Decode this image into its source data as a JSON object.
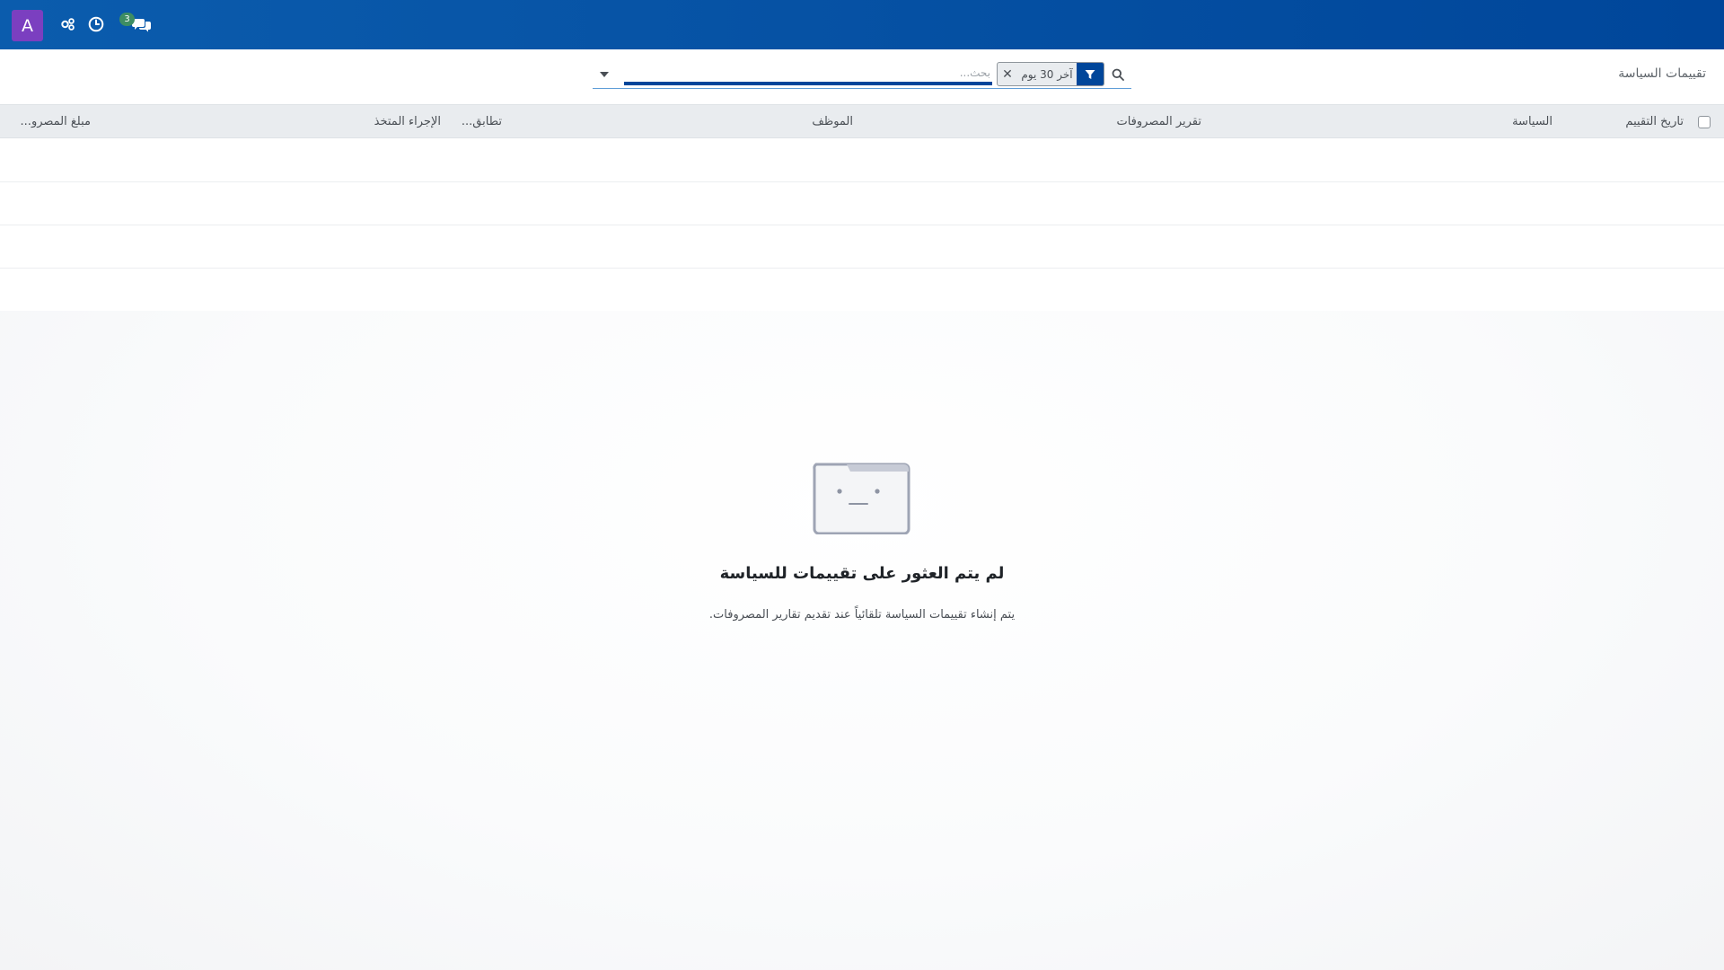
{
  "navbar": {
    "user_initial": "A",
    "messages_badge": "3",
    "icons": [
      "users-gear-icon",
      "clock-icon",
      "chat-icon"
    ],
    "background": "#00469a",
    "avatar_color": "#7b3fc0"
  },
  "control_panel": {
    "breadcrumb": "تقييمات السياسة",
    "search": {
      "placeholder": "بحث...",
      "value": "",
      "facet_label": "آخر 30 يوم"
    }
  },
  "list": {
    "columns": [
      "تاريخ التقييم",
      "السياسة",
      "تقرير المصروفات",
      "الموظف",
      "تطابق...",
      "الإجراء المتخذ",
      "مبلغ المصرو..."
    ]
  },
  "empty_state": {
    "title": "لم يتم العثور على تقييمات للسياسة",
    "description": "يتم إنشاء تقييمات السياسة تلقائياً عند تقديم تقارير المصروفات."
  }
}
